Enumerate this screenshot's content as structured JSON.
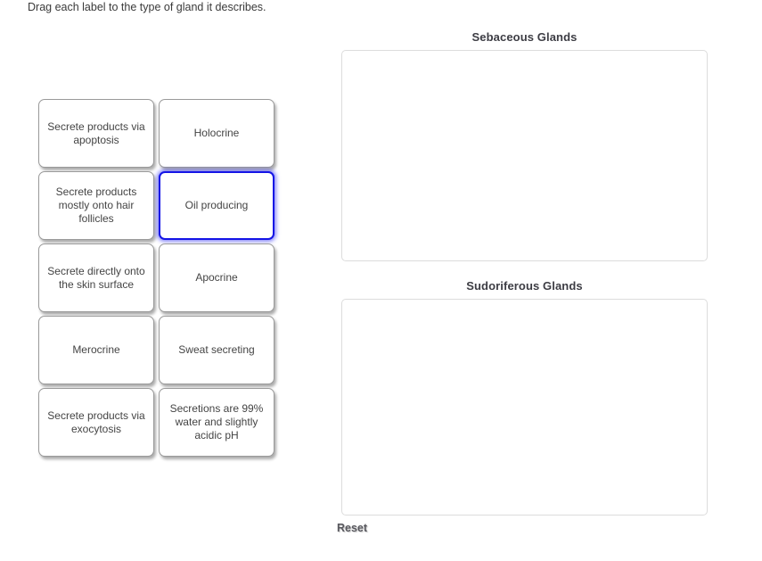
{
  "instruction": "Drag each label to the type of gland it describes.",
  "tiles": [
    {
      "label": "Secrete products via apoptosis",
      "selected": false
    },
    {
      "label": "Holocrine",
      "selected": false
    },
    {
      "label": "Secrete products mostly onto hair follicles",
      "selected": false
    },
    {
      "label": "Oil producing",
      "selected": true
    },
    {
      "label": "Secrete directly onto the skin surface",
      "selected": false
    },
    {
      "label": "Apocrine",
      "selected": false
    },
    {
      "label": "Merocrine",
      "selected": false
    },
    {
      "label": "Sweat secreting",
      "selected": false
    },
    {
      "label": "Secrete products via exocytosis",
      "selected": false
    },
    {
      "label": "Secretions are 99% water and slightly acidic pH",
      "selected": false
    }
  ],
  "zones": [
    {
      "title": "Sebaceous Glands",
      "items": []
    },
    {
      "title": "Sudoriferous Glands",
      "items": []
    }
  ],
  "reset_label": "Reset",
  "colors": {
    "selected_border": "#1414e6",
    "tile_border": "#9a9a9a",
    "zone_border": "#dcdcdc",
    "text": "#444444"
  }
}
